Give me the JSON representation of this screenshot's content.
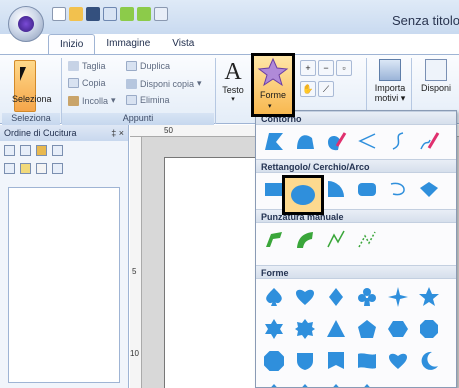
{
  "titlebar": {
    "title": "Senza titolo -"
  },
  "tabs": [
    {
      "label": "Inizio",
      "active": true
    },
    {
      "label": "Immagine",
      "active": false
    },
    {
      "label": "Vista",
      "active": false
    }
  ],
  "ribbon": {
    "seleziona": {
      "label": "Seleziona"
    },
    "appunti": {
      "taglia": "Taglia",
      "copia": "Copia",
      "incolla": "Incolla",
      "duplica": "Duplica",
      "disponi_copia": "Disponi copia",
      "elimina": "Elimina"
    },
    "testo": {
      "label": "Testo",
      "glyph": "A"
    },
    "forme": {
      "label": "Forme"
    },
    "importa": {
      "label1": "Importa",
      "label2": "motivi"
    },
    "disponi": {
      "label": "Disponi"
    },
    "group_labels": {
      "seleziona": "Seleziona",
      "appunti": "Appunti"
    }
  },
  "left_pane": {
    "title": "Ordine di Cucitura",
    "controls": "‡ ×"
  },
  "ruler": {
    "top_mark": "50",
    "left_mark_a": "5",
    "left_mark_b": "10"
  },
  "shape_menu": {
    "sections": [
      {
        "title": "Contorno"
      },
      {
        "title": "Rettangolo/ Cerchio/Arco"
      },
      {
        "title": "Punzatura manuale"
      },
      {
        "title": "Forme"
      }
    ]
  },
  "colors": {
    "accent_orange": "#f6a64a",
    "shape_blue": "#2f8fdc",
    "shape_green": "#3aa63a",
    "ribbon_blue": "#c9daf0"
  }
}
